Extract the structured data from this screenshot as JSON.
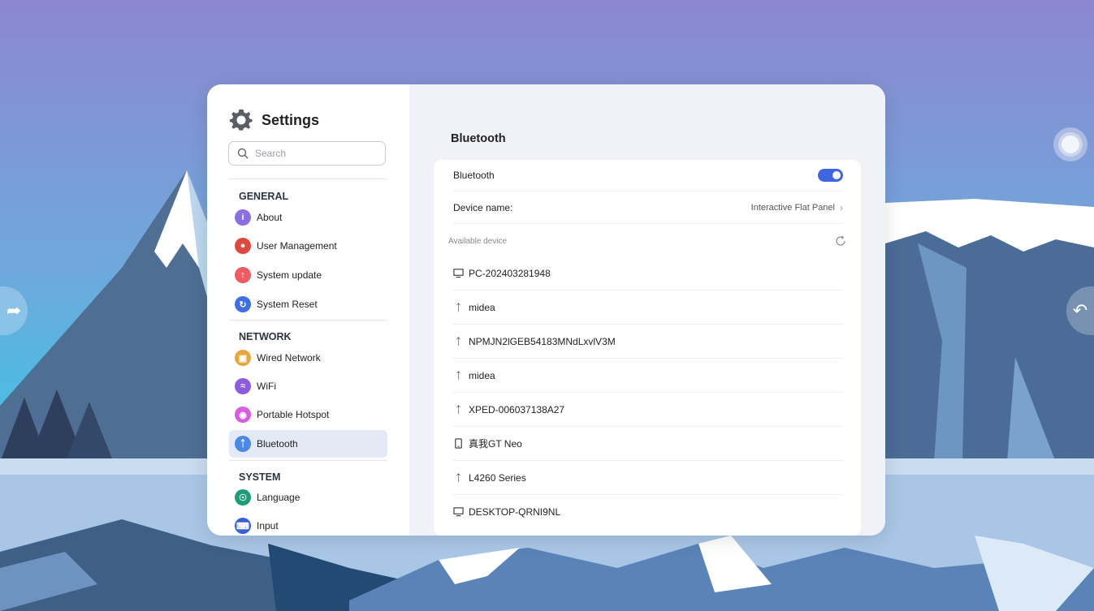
{
  "app": {
    "title": "Settings",
    "search_placeholder": "Search"
  },
  "sidebar": {
    "sections": [
      {
        "title": "GENERAL"
      },
      {
        "title": "NETWORK"
      },
      {
        "title": "SYSTEM"
      }
    ],
    "items": [
      {
        "label": "About",
        "icon": "info-icon",
        "color": "#8b6fe0"
      },
      {
        "label": "User Management",
        "icon": "users-icon",
        "color": "#e0483e"
      },
      {
        "label": "System update",
        "icon": "update-icon",
        "color": "#ee5b66"
      },
      {
        "label": "System Reset",
        "icon": "reset-icon",
        "color": "#3d6ee8"
      },
      {
        "label": "Wired Network",
        "icon": "ethernet-icon",
        "color": "#e9a73b"
      },
      {
        "label": "WiFi",
        "icon": "wifi-icon",
        "color": "#8b5ce0"
      },
      {
        "label": "Portable Hotspot",
        "icon": "hotspot-icon",
        "color": "#d75ee0"
      },
      {
        "label": "Bluetooth",
        "icon": "bluetooth-icon",
        "color": "#4b88e8",
        "active": true
      },
      {
        "label": "Language",
        "icon": "globe-icon",
        "color": "#1f9c7a"
      },
      {
        "label": "Input",
        "icon": "input-icon",
        "color": "#3760d8"
      }
    ]
  },
  "panel": {
    "title": "Bluetooth",
    "bluetooth_label": "Bluetooth",
    "bluetooth_enabled": true,
    "device_name_label": "Device name:",
    "device_name_value": "Interactive Flat Panel",
    "available_label": "Available device",
    "devices": [
      {
        "name": "PC-202403281948",
        "icon": "computer-icon"
      },
      {
        "name": "midea",
        "icon": "bluetooth-icon"
      },
      {
        "name": "NPMJN2lGEB54183MNdLxvlV3M",
        "icon": "bluetooth-icon"
      },
      {
        "name": "midea",
        "icon": "bluetooth-icon"
      },
      {
        "name": "XPED-006037138A27",
        "icon": "bluetooth-icon"
      },
      {
        "name": "真我GT Neo",
        "icon": "phone-icon"
      },
      {
        "name": "L4260 Series",
        "icon": "bluetooth-icon"
      },
      {
        "name": "DESKTOP-QRNI9NL",
        "icon": "computer-icon"
      }
    ]
  },
  "colors": {
    "accent": "#3e66e0",
    "active_bg": "#e3e9f5",
    "content_bg": "#f1f2f7"
  }
}
